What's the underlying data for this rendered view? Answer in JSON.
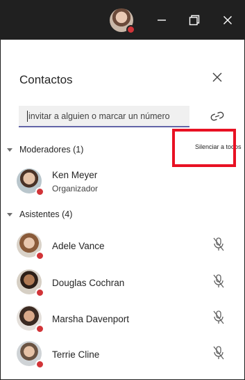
{
  "panel": {
    "title": "Contactos",
    "search_placeholder": "invitar a alguien o marcar un número",
    "mute_all_label": "Silenciar a todos"
  },
  "moderators": {
    "header": "Moderadores (1)",
    "people": [
      {
        "name": "Ken Meyer",
        "role": "Organizador",
        "status_color": "#d13438"
      }
    ]
  },
  "attendees": {
    "header": "Asistentes (4)",
    "people": [
      {
        "name": "Adele Vance",
        "status_color": "#d13438",
        "mic": "mic-off-icon"
      },
      {
        "name": "Douglas Cochran",
        "status_color": "#d13438",
        "mic": "mic-off-icon"
      },
      {
        "name": "Marsha Davenport",
        "status_color": "#d13438",
        "mic": "mic-off-icon"
      },
      {
        "name": "Terrie Cline",
        "status_color": "#d13438",
        "mic": "mic-off-icon"
      }
    ]
  },
  "colors": {
    "titlebar": "#202020",
    "accent": "#6264a7",
    "busy": "#d13438",
    "highlight": "#e81123"
  },
  "icons": {
    "minimize": "minimize-icon",
    "restore": "restore-icon",
    "close": "close-icon",
    "share_link": "link-icon",
    "collapse": "chevron-down-icon"
  }
}
